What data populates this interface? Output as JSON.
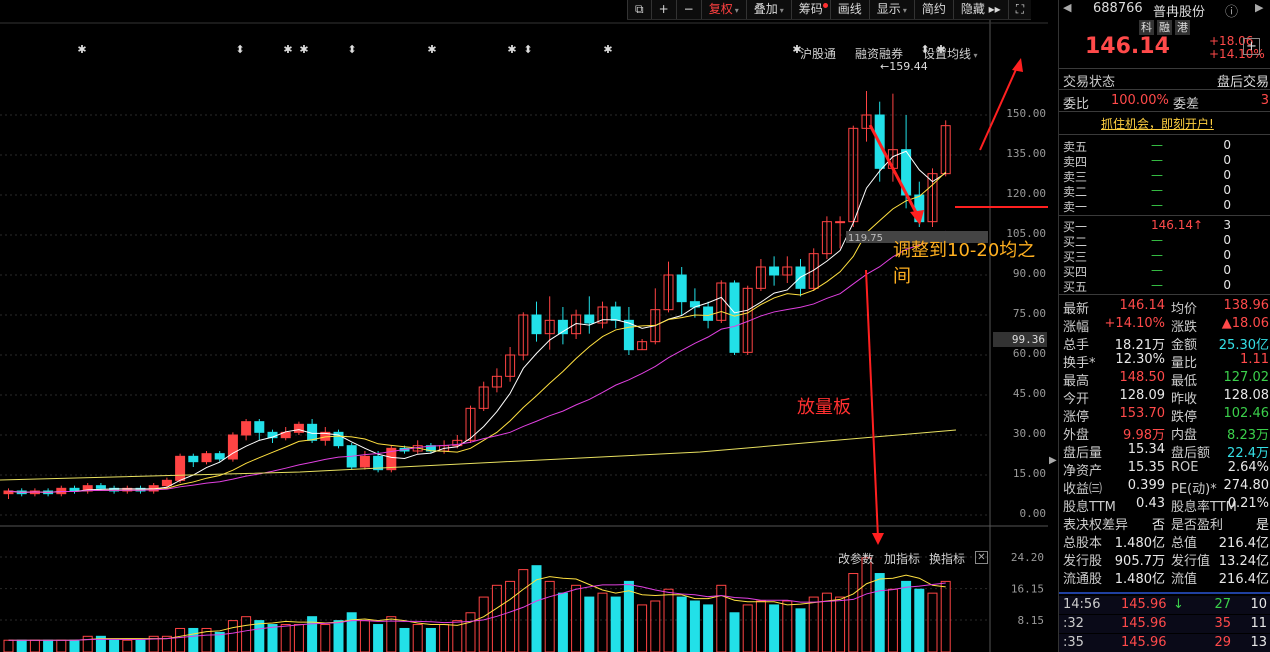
{
  "toolbar": {
    "items": [
      {
        "label": "⧉"
      },
      {
        "label": "+"
      },
      {
        "label": "−"
      },
      {
        "label": "复权",
        "active": true,
        "arrow": true
      },
      {
        "label": "叠加",
        "arrow": true
      },
      {
        "label": "筹码",
        "dot": true
      },
      {
        "label": "画线"
      },
      {
        "label": "显示",
        "arrow": true
      },
      {
        "label": "简约"
      },
      {
        "label": "隐藏 ▸▸"
      },
      {
        "label": "⛶"
      }
    ]
  },
  "subheader": {
    "links": [
      "沪股通",
      "融资融券",
      "设置均线"
    ]
  },
  "price_axis": [
    "150.00",
    "135.00",
    "120.00",
    "105.00",
    "90.00",
    "75.00",
    "60.00",
    "45.00",
    "30.00",
    "15.00",
    "0.00"
  ],
  "current_price_label": "99.36",
  "high_label": "159.44",
  "mid_label": "119.75",
  "volume_axis": [
    "24.20",
    "16.15",
    "8.15"
  ],
  "volume_toolbar": [
    "改参数",
    "加指标",
    "换指标"
  ],
  "annotations": {
    "adjust": "调整到10-20均之间",
    "volume": "放量板"
  },
  "chart_data": {
    "type": "candlestick",
    "ylim": [
      0,
      165
    ],
    "candles": [
      [
        8,
        9,
        6,
        10
      ],
      [
        9,
        8,
        7,
        10
      ],
      [
        8,
        9,
        7,
        10
      ],
      [
        9,
        8,
        7,
        10
      ],
      [
        8,
        10,
        7,
        11
      ],
      [
        10,
        9,
        8,
        11
      ],
      [
        9,
        11,
        8,
        12
      ],
      [
        11,
        10,
        9,
        12
      ],
      [
        10,
        9,
        8,
        11
      ],
      [
        9,
        10,
        8,
        11
      ],
      [
        10,
        9,
        8,
        11
      ],
      [
        9,
        11,
        8,
        12
      ],
      [
        11,
        13,
        10,
        14
      ],
      [
        13,
        22,
        12,
        23
      ],
      [
        22,
        20,
        18,
        23
      ],
      [
        20,
        23,
        19,
        24
      ],
      [
        23,
        21,
        20,
        24
      ],
      [
        21,
        30,
        20,
        31
      ],
      [
        30,
        35,
        28,
        36
      ],
      [
        35,
        31,
        28,
        36
      ],
      [
        31,
        29,
        27,
        32
      ],
      [
        29,
        31,
        28,
        33
      ],
      [
        31,
        34,
        30,
        35
      ],
      [
        34,
        28,
        27,
        36
      ],
      [
        28,
        31,
        26,
        33
      ],
      [
        31,
        26,
        25,
        32
      ],
      [
        26,
        18,
        17,
        27
      ],
      [
        18,
        22,
        17,
        24
      ],
      [
        22,
        17,
        16,
        24
      ],
      [
        17,
        25,
        16,
        26
      ],
      [
        25,
        24,
        23,
        26
      ],
      [
        24,
        26,
        23,
        28
      ],
      [
        26,
        24,
        23,
        27
      ],
      [
        24,
        26,
        23,
        28
      ],
      [
        26,
        28,
        25,
        30
      ],
      [
        28,
        40,
        27,
        41
      ],
      [
        40,
        48,
        39,
        50
      ],
      [
        48,
        52,
        46,
        55
      ],
      [
        52,
        60,
        50,
        63
      ],
      [
        60,
        75,
        58,
        76
      ],
      [
        75,
        68,
        65,
        80
      ],
      [
        68,
        73,
        62,
        82
      ],
      [
        73,
        68,
        64,
        78
      ],
      [
        68,
        75,
        66,
        77
      ],
      [
        75,
        72,
        68,
        82
      ],
      [
        72,
        78,
        70,
        80
      ],
      [
        78,
        73,
        70,
        80
      ],
      [
        73,
        62,
        60,
        78
      ],
      [
        62,
        65,
        62,
        66
      ],
      [
        65,
        77,
        64,
        85
      ],
      [
        77,
        90,
        76,
        95
      ],
      [
        90,
        80,
        75,
        93
      ],
      [
        80,
        78,
        74,
        85
      ],
      [
        78,
        73,
        70,
        80
      ],
      [
        73,
        87,
        72,
        88
      ],
      [
        87,
        61,
        60,
        88
      ],
      [
        61,
        85,
        60,
        86
      ],
      [
        85,
        93,
        84,
        96
      ],
      [
        93,
        90,
        86,
        97
      ],
      [
        90,
        93,
        87,
        97
      ],
      [
        93,
        85,
        82,
        96
      ],
      [
        85,
        98,
        84,
        100
      ],
      [
        98,
        110,
        96,
        112
      ],
      [
        110,
        110,
        100,
        112
      ],
      [
        110,
        145,
        108,
        146
      ],
      [
        145,
        150,
        140,
        159
      ],
      [
        150,
        130,
        125,
        155
      ],
      [
        130,
        137,
        125,
        158
      ],
      [
        137,
        120,
        115,
        150
      ],
      [
        120,
        110,
        108,
        125
      ],
      [
        110,
        128,
        108,
        130
      ],
      [
        128,
        146,
        127,
        148
      ]
    ],
    "volume": [
      3,
      3,
      3,
      3,
      3,
      3,
      4,
      4,
      3,
      3,
      3,
      4,
      4,
      6,
      6,
      6,
      5,
      8,
      9,
      8,
      7,
      7,
      7,
      9,
      7,
      8,
      10,
      8,
      7,
      9,
      6,
      7,
      6,
      7,
      8,
      10,
      14,
      17,
      18,
      21,
      22,
      18,
      15,
      17,
      14,
      15,
      14,
      18,
      12,
      13,
      16,
      14,
      13,
      12,
      17,
      10,
      12,
      13,
      12,
      13,
      11,
      14,
      15,
      14,
      20,
      24,
      20,
      16,
      18,
      16,
      15,
      18
    ]
  },
  "panel": {
    "code": "688766",
    "name": "普冉股份",
    "badges": [
      "科",
      "融",
      "港"
    ],
    "price": "146.14",
    "change": "+18.06",
    "change_pct": "+14.10%",
    "trade_status_label": "交易状态",
    "trade_status_value": "盘后交易",
    "weibi_label": "委比",
    "weibi_value": "100.00%",
    "weicha_label": "委差",
    "weicha_value": "3",
    "promo": "抓住机会，即刻开户!",
    "asks": [
      {
        "label": "卖五",
        "price": "—",
        "vol": "0"
      },
      {
        "label": "卖四",
        "price": "—",
        "vol": "0"
      },
      {
        "label": "卖三",
        "price": "—",
        "vol": "0"
      },
      {
        "label": "卖二",
        "price": "—",
        "vol": "0"
      },
      {
        "label": "卖一",
        "price": "—",
        "vol": "0"
      }
    ],
    "bids": [
      {
        "label": "买一",
        "price": "146.14↑",
        "vol": "3"
      },
      {
        "label": "买二",
        "price": "—",
        "vol": "0"
      },
      {
        "label": "买三",
        "price": "—",
        "vol": "0"
      },
      {
        "label": "买四",
        "price": "—",
        "vol": "0"
      },
      {
        "label": "买五",
        "price": "—",
        "vol": "0"
      }
    ],
    "stats": [
      {
        "l1": "最新",
        "v1": "146.14",
        "c1": "red",
        "l2": "均价",
        "v2": "138.96",
        "c2": "red"
      },
      {
        "l1": "涨幅",
        "v1": "+14.10%",
        "c1": "red",
        "l2": "涨跌",
        "v2": "▲18.06",
        "c2": "red"
      },
      {
        "l1": "总手",
        "v1": "18.21万",
        "c1": "white",
        "l2": "金额",
        "v2": "25.30亿",
        "c2": "cyan"
      },
      {
        "l1": "换手*",
        "v1": "12.30%",
        "c1": "white",
        "l2": "量比",
        "v2": "1.11",
        "c2": "red"
      },
      {
        "l1": "最高",
        "v1": "148.50",
        "c1": "red",
        "l2": "最低",
        "v2": "127.02",
        "c2": "green"
      },
      {
        "l1": "今开",
        "v1": "128.09",
        "c1": "white",
        "l2": "昨收",
        "v2": "128.08",
        "c2": "white"
      },
      {
        "l1": "涨停",
        "v1": "153.70",
        "c1": "red",
        "l2": "跌停",
        "v2": "102.46",
        "c2": "green"
      },
      {
        "l1": "外盘",
        "v1": "9.98万",
        "c1": "red",
        "l2": "内盘",
        "v2": "8.23万",
        "c2": "green"
      },
      {
        "l1": "盘后量",
        "v1": "15.34",
        "c1": "white",
        "l2": "盘后额",
        "v2": "22.4万",
        "c2": "cyan"
      },
      {
        "l1": "净资产",
        "v1": "15.35",
        "c1": "white",
        "l2": "ROE",
        "v2": "2.64%",
        "c2": "white"
      },
      {
        "l1": "收益㈢",
        "v1": "0.399",
        "c1": "white",
        "l2": "PE(动)*",
        "v2": "274.80",
        "c2": "white"
      },
      {
        "l1": "股息TTM",
        "v1": "0.43",
        "c1": "white",
        "l2": "股息率TTM",
        "v2": "0.21%",
        "c2": "white"
      },
      {
        "l1": "表决权差异",
        "v1": "否",
        "c1": "white",
        "l2": "是否盈利",
        "v2": "是",
        "c2": "white"
      },
      {
        "l1": "总股本",
        "v1": "1.480亿",
        "c1": "white",
        "l2": "总值",
        "v2": "216.4亿",
        "c2": "white"
      },
      {
        "l1": "发行股",
        "v1": "905.7万",
        "c1": "white",
        "l2": "发行值",
        "v2": "13.24亿",
        "c2": "white"
      },
      {
        "l1": "流通股",
        "v1": "1.480亿",
        "c1": "white",
        "l2": "流值",
        "v2": "216.4亿",
        "c2": "white"
      }
    ],
    "ticks": [
      {
        "time": "14:56",
        "price": "145.96",
        "arrow": "↓",
        "vol": "27",
        "n": "10"
      },
      {
        "time": ":32",
        "price": "145.96",
        "arrow": "",
        "vol": "35",
        "n": "11"
      },
      {
        "time": ":35",
        "price": "145.96",
        "arrow": "",
        "vol": "29",
        "n": "13"
      }
    ]
  }
}
